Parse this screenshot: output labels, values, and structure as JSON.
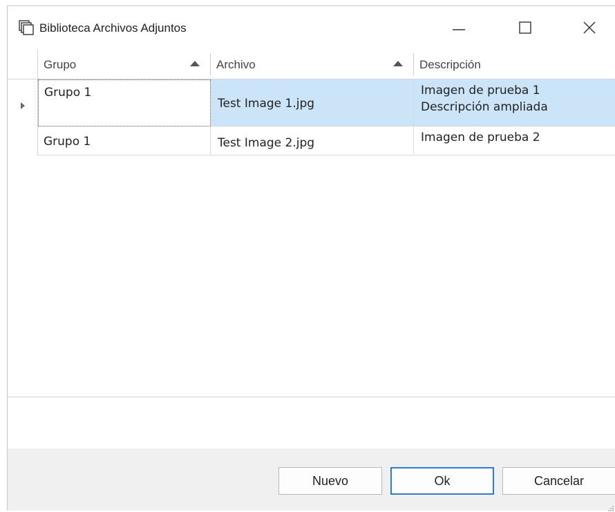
{
  "window": {
    "title": "Biblioteca Archivos Adjuntos",
    "icon": "copy-icon",
    "controls": [
      "minimize-icon",
      "maximize-icon",
      "close-icon"
    ]
  },
  "grid": {
    "columns": [
      {
        "label": "Grupo",
        "sort": "ascending"
      },
      {
        "label": "Archivo",
        "sort": "ascending"
      },
      {
        "label": "Descripción",
        "sort": "none"
      }
    ],
    "rows": [
      {
        "grupo": "Grupo 1",
        "archivo": "Test Image 1.jpg",
        "descripcion_line1": "Imagen de prueba 1",
        "descripcion_line2": "Descripción ampliada",
        "selected": true
      },
      {
        "grupo": "Grupo 1",
        "archivo": "Test Image 2.jpg",
        "descripcion_line1": "Imagen de prueba 2",
        "selected": false
      }
    ]
  },
  "buttons": {
    "nuevo": "Nuevo",
    "ok": "Ok",
    "cancelar": "Cancelar"
  },
  "colors": {
    "selection": "#cce4f7",
    "accent": "#2f7ccf",
    "footer": "#f0f0f0"
  }
}
